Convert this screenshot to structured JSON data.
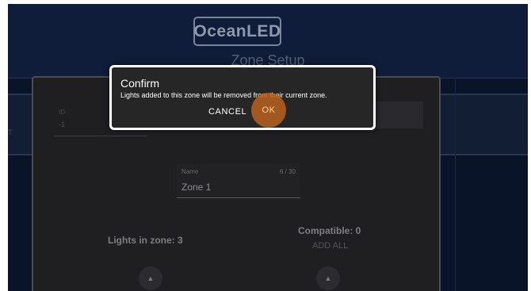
{
  "header": {
    "logo_text": "OceanLED",
    "title": "Zone Setup"
  },
  "background": {
    "row_text": "T"
  },
  "zone_form": {
    "id_label": "ID",
    "id_value": "-1",
    "name_label": "Name",
    "name_count": "6 / 30",
    "name_value": "Zone 1",
    "lights_in_zone": "Lights in zone: 3",
    "compatible": "Compatible: 0",
    "add_all": "ADD ALL",
    "up_icon_glyph": "▲"
  },
  "dialog": {
    "title": "Confirm",
    "message": "Lights added to this zone will be removed from their current zone.",
    "cancel_label": "CANCEL",
    "ok_label": "OK"
  },
  "colors": {
    "accent": "#b8621f",
    "background": "#0a1428",
    "dialog_bg": "#262626"
  }
}
